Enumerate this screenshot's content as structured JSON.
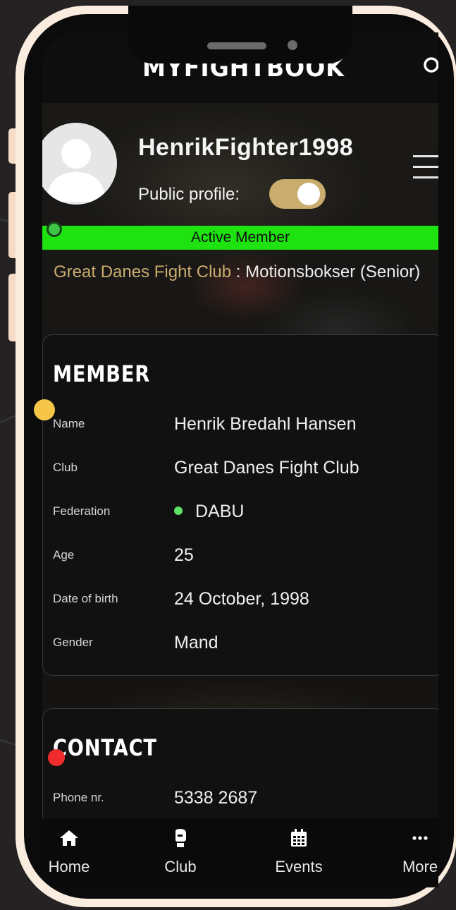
{
  "app": {
    "logo": "MYFIGHTBOOK"
  },
  "profile": {
    "username": "HenrikFighter1998",
    "public_label": "Public profile:",
    "public_enabled": true,
    "status": "Active Member",
    "club": "Great Danes Fight Club",
    "separator": " : ",
    "membership": "Motionsbokser (Senior)"
  },
  "member": {
    "title": "MEMBER",
    "rows": [
      {
        "label": "Name",
        "value": "Henrik Bredahl Hansen"
      },
      {
        "label": "Club",
        "value": "Great Danes Fight Club"
      },
      {
        "label": "Federation",
        "value": "DABU"
      },
      {
        "label": "Age",
        "value": "25"
      },
      {
        "label": "Date of birth",
        "value": "24 October, 1998"
      },
      {
        "label": "Gender",
        "value": "Mand"
      }
    ]
  },
  "contact": {
    "title": "CONTACT",
    "rows": [
      {
        "label": "Phone nr.",
        "value": "5338 2687"
      }
    ]
  },
  "nav": {
    "items": [
      {
        "label": "Home",
        "icon": "home-icon"
      },
      {
        "label": "Club",
        "icon": "boxing-glove-icon"
      },
      {
        "label": "Events",
        "icon": "calendar-icon"
      },
      {
        "label": "More",
        "icon": "more-dots-icon"
      }
    ]
  },
  "colors": {
    "accent_gold": "#c9ac6e",
    "active_green": "#1ee310",
    "federation_dot": "#5de266",
    "marker_green": "#3fc445",
    "marker_yellow": "#f7c548",
    "marker_red": "#ef2b2b",
    "frame": "#faecde"
  }
}
